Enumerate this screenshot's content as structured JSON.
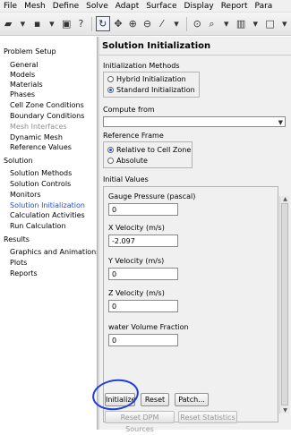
{
  "menu": [
    "File",
    "Mesh",
    "Define",
    "Solve",
    "Adapt",
    "Surface",
    "Display",
    "Report",
    "Para"
  ],
  "sidebar": {
    "groups": [
      {
        "label": "Problem Setup",
        "items": [
          {
            "label": "General"
          },
          {
            "label": "Models"
          },
          {
            "label": "Materials"
          },
          {
            "label": "Phases"
          },
          {
            "label": "Cell Zone Conditions"
          },
          {
            "label": "Boundary Conditions"
          },
          {
            "label": "Mesh Interfaces",
            "disabled": true
          },
          {
            "label": "Dynamic Mesh"
          },
          {
            "label": "Reference Values"
          }
        ]
      },
      {
        "label": "Solution",
        "items": [
          {
            "label": "Solution Methods"
          },
          {
            "label": "Solution Controls"
          },
          {
            "label": "Monitors"
          },
          {
            "label": "Solution Initialization",
            "selected": true
          },
          {
            "label": "Calculation Activities"
          },
          {
            "label": "Run Calculation"
          }
        ]
      },
      {
        "label": "Results",
        "items": [
          {
            "label": "Graphics and Animations"
          },
          {
            "label": "Plots"
          },
          {
            "label": "Reports"
          }
        ]
      }
    ]
  },
  "panel": {
    "title": "Solution Initialization",
    "init_methods": {
      "label": "Initialization Methods",
      "options": [
        {
          "label": "Hybrid  Initialization",
          "selected": false
        },
        {
          "label": "Standard Initialization",
          "selected": true
        }
      ]
    },
    "compute_from": {
      "label": "Compute from",
      "value": ""
    },
    "reference_frame": {
      "label": "Reference Frame",
      "options": [
        {
          "label": "Relative to Cell Zone",
          "selected": true
        },
        {
          "label": "Absolute",
          "selected": false
        }
      ]
    },
    "initial_values": {
      "label": "Initial Values",
      "fields": [
        {
          "label": "Gauge Pressure (pascal)",
          "value": "0"
        },
        {
          "label": "X Velocity (m/s)",
          "value": "-2.097"
        },
        {
          "label": "Y Velocity (m/s)",
          "value": "0"
        },
        {
          "label": "Z Velocity (m/s)",
          "value": "0"
        },
        {
          "label": "water Volume Fraction",
          "value": "0"
        }
      ]
    },
    "buttons": {
      "initialize": "Initialize",
      "reset": "Reset",
      "patch": "Patch...",
      "reset_dpm": "Reset DPM Sources",
      "reset_statistics": "Reset Statistics"
    }
  },
  "colors": {
    "annotation_circle": "#1f3fd8",
    "selected_item": "#1f4fd6"
  }
}
